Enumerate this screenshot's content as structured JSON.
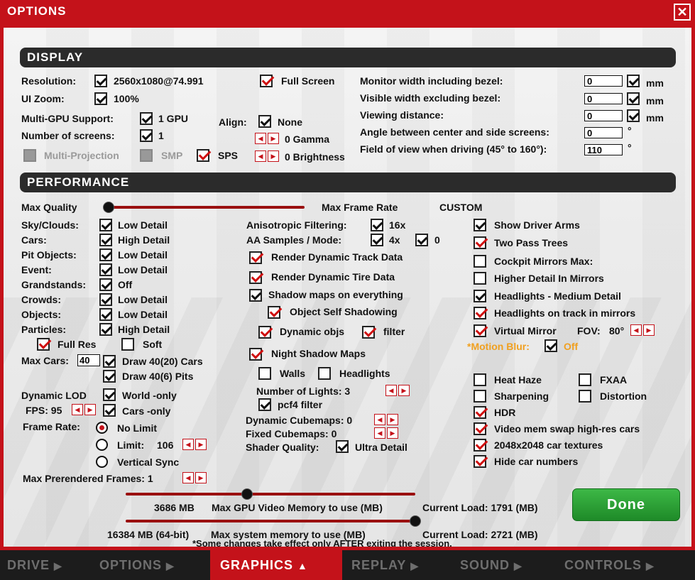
{
  "window": {
    "title": "OPTIONS",
    "close_glyph": "✕"
  },
  "sections": {
    "display": "DISPLAY",
    "performance": "PERFORMANCE"
  },
  "display": {
    "resolution_label": "Resolution:",
    "resolution_value": "2560x1080@74.991",
    "ui_zoom_label": "UI Zoom:",
    "ui_zoom_value": "100%",
    "multigpu_label": "Multi-GPU Support:",
    "multigpu_value": "1 GPU",
    "screens_label": "Number of screens:",
    "screens_value": "1",
    "multiproj": "Multi-Projection",
    "smp": "SMP",
    "sps": "SPS",
    "fullscreen": "Full Screen",
    "align_label": "Align:",
    "align_value": "None",
    "gamma": "0  Gamma",
    "brightness": "0  Brightness",
    "monitor_width": "Monitor width including bezel:",
    "visible_width": "Visible width excluding bezel:",
    "viewing_distance": "Viewing distance:",
    "angle": "Angle between center and side screens:",
    "fov": "Field of view when driving (45° to 160°):",
    "monitor_width_val": "0",
    "visible_width_val": "0",
    "viewing_distance_val": "0",
    "angle_val": "0",
    "fov_val": "110",
    "unit_mm": "mm",
    "unit_deg": "°"
  },
  "performance": {
    "max_quality": "Max Quality",
    "max_frame_rate": "Max Frame Rate",
    "custom": "CUSTOM",
    "detail_rows": [
      {
        "label": "Sky/Clouds:",
        "value": "Low Detail"
      },
      {
        "label": "Cars:",
        "value": "High Detail"
      },
      {
        "label": "Pit Objects:",
        "value": "Low Detail"
      },
      {
        "label": "Event:",
        "value": "Low Detail"
      },
      {
        "label": "Grandstands:",
        "value": "Off"
      },
      {
        "label": "Crowds:",
        "value": "Low Detail"
      },
      {
        "label": "Objects:",
        "value": "Low Detail"
      },
      {
        "label": "Particles:",
        "value": "High Detail"
      }
    ],
    "full_res": "Full Res",
    "soft": "Soft",
    "max_cars_label": "Max Cars:",
    "max_cars_value": "40",
    "draw_cars": "Draw 40(20) Cars",
    "draw_pits": "Draw 40(6) Pits",
    "dynamic_lod": "Dynamic LOD",
    "world_only": "World -only",
    "fps": "FPS: 95",
    "cars_only": "Cars -only",
    "frame_rate": "Frame Rate:",
    "no_limit": "No Limit",
    "limit": "Limit:",
    "limit_value": "106",
    "vsync": "Vertical Sync",
    "max_prerendered": "Max Prerendered Frames: 1",
    "aniso_label": "Anisotropic Filtering:",
    "aniso_value": "16x",
    "aa_label": "AA Samples / Mode:",
    "aa_value": "4x",
    "aa_mode": "0",
    "render_track": "Render Dynamic Track Data",
    "render_tire": "Render Dynamic Tire Data",
    "shadow_maps": "Shadow maps on everything",
    "self_shadow": "Object Self Shadowing",
    "dynamic_objs": "Dynamic objs",
    "filter": "filter",
    "night_shadow": "Night Shadow Maps",
    "walls": "Walls",
    "headlights": "Headlights",
    "num_lights": "Number of Lights: 3",
    "pcf4": "pcf4 filter",
    "dyn_cubemaps": "Dynamic Cubemaps: 0",
    "fixed_cubemaps": "Fixed Cubemaps: 0",
    "shader_label": "Shader Quality:",
    "shader_value": "Ultra Detail",
    "show_arms": "Show Driver Arms",
    "two_pass": "Two Pass Trees",
    "cockpit_mirrors": "Cockpit Mirrors  Max:",
    "higher_detail_mirrors": "Higher Detail In Mirrors",
    "headlights_med": "Headlights - Medium Detail",
    "headlights_track": "Headlights on track in mirrors",
    "virtual_mirror": "Virtual Mirror",
    "fov_label": "FOV:",
    "fov_value": "80°",
    "motion_blur": "*Motion Blur:",
    "motion_blur_value": "Off",
    "heat_haze": "Heat Haze",
    "fxaa": "FXAA",
    "sharpening": "Sharpening",
    "distortion": "Distortion",
    "hdr": "HDR",
    "video_swap": "Video mem swap high-res cars",
    "car_textures": "2048x2048 car textures",
    "hide_numbers": "Hide car numbers",
    "gpu_mem_value": "3686 MB",
    "gpu_mem_label": "Max GPU Video Memory to use (MB)",
    "gpu_load": "Current Load: 1791 (MB)",
    "sys_mem_value": "16384 MB (64-bit)",
    "sys_mem_label": "Max system memory to use (MB)",
    "sys_load": "Current Load: 2721 (MB)",
    "note": "*Some changes take effect only AFTER exiting the session.",
    "quality_slider": 0.0,
    "gpu_slider": 0.42,
    "sys_slider": 1.0
  },
  "done": "Done",
  "tabs": [
    {
      "label": "DRIVE",
      "icon": "▶"
    },
    {
      "label": "OPTIONS",
      "icon": "▶"
    },
    {
      "label": "GRAPHICS",
      "icon": "▲"
    },
    {
      "label": "REPLAY",
      "icon": "▶"
    },
    {
      "label": "SOUND",
      "icon": "▶"
    },
    {
      "label": "CONTROLS",
      "icon": "▶"
    }
  ],
  "colors": {
    "accent": "#c4121a",
    "done_green": "#2aa134",
    "motion_blur_orange": "#f0a020"
  }
}
